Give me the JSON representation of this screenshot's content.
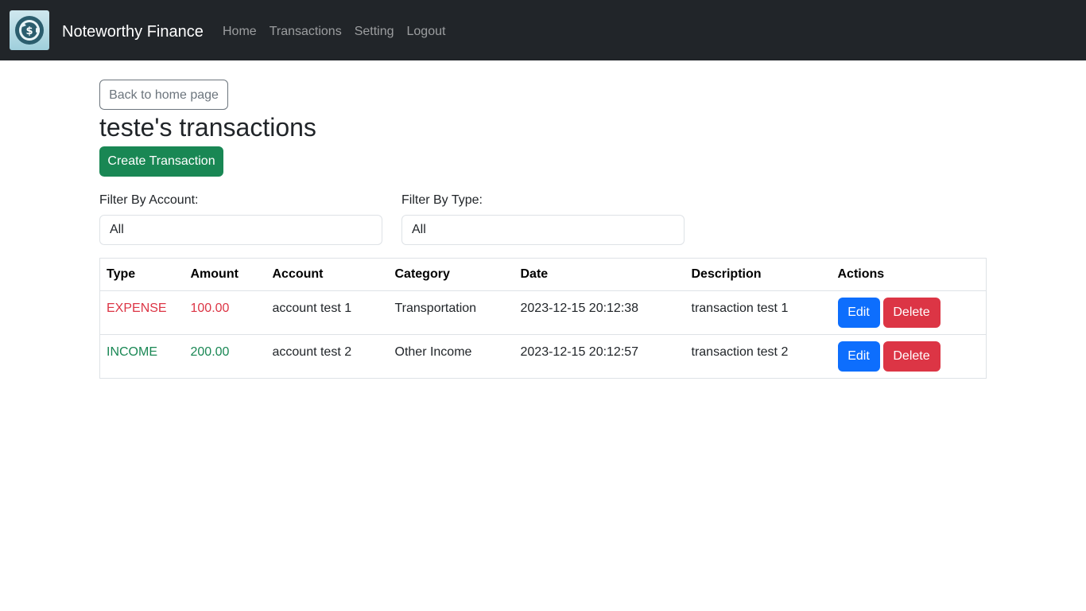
{
  "navbar": {
    "brand": "Noteworthy Finance",
    "links": [
      "Home",
      "Transactions",
      "Setting",
      "Logout"
    ]
  },
  "main": {
    "back_button": "Back to home page",
    "title": "teste's transactions",
    "create_button": "Create Transaction",
    "filter_account": {
      "label": "Filter By Account:",
      "value": "All"
    },
    "filter_type": {
      "label": "Filter By Type:",
      "value": "All"
    }
  },
  "table": {
    "headers": [
      "Type",
      "Amount",
      "Account",
      "Category",
      "Date",
      "Description",
      "Actions"
    ],
    "rows": [
      {
        "type": "EXPENSE",
        "amount": "100.00",
        "account": "account test 1",
        "category": "Transportation",
        "date": "2023-12-15 20:12:38",
        "description": "transaction test 1"
      },
      {
        "type": "INCOME",
        "amount": "200.00",
        "account": "account test 2",
        "category": "Other Income",
        "date": "2023-12-15 20:12:57",
        "description": "transaction test 2"
      }
    ],
    "edit_label": "Edit",
    "delete_label": "Delete"
  },
  "colors": {
    "navbar_bg": "#212529",
    "expense": "#dc3545",
    "income": "#198754",
    "primary": "#0d6efd",
    "success": "#198754",
    "danger": "#dc3545"
  },
  "icons": {
    "brand": "piggy-bank-dollar-icon"
  }
}
